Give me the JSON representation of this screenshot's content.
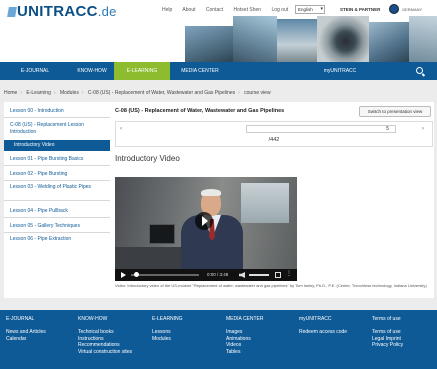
{
  "header": {
    "logo_text": "UNITRACC",
    "logo_domain": ".de",
    "top_links": [
      "Help",
      "About",
      "Contact",
      "Hotset Shen",
      "Log out"
    ],
    "language": "English",
    "partner": "STEIN & PARTNER",
    "partner_country": "GERMANY"
  },
  "nav": {
    "items": [
      "E-JOURNAL",
      "KNOW-HOW",
      "E-LEARNING",
      "MEDIA CENTER",
      "myUNITRACC"
    ],
    "active_index": 2
  },
  "breadcrumb": [
    "Home",
    "E-Learning",
    "Modules",
    "C-08 (US) - Replacement of Water, Wastewater and Gas Pipelines",
    "course view"
  ],
  "sidebar": {
    "items": [
      "Lesson 00 - Introduction",
      "C-08 (US) - Replacement Lesson Introduction",
      "Introductory Video",
      "Lesson 01 - Pipe Bursting Basics",
      "Lesson 02 - Pipe Bursting",
      "Lesson 03 - Welding of Plastic Pipes",
      "Lesson 04 - Pipe Pullback",
      "Lesson 05 - Gallery Techniques",
      "Lesson 06 - Pipe Extraction"
    ],
    "active_index": 2
  },
  "main": {
    "lesson_title": "C-08 (US) - Replacement of Water, Wastewater and Gas Pipelines",
    "switch_button": "Switch to presentation view",
    "page_current": "5",
    "page_total": "/442",
    "section_title": "Introductory Video",
    "video_time": "0:00 / 3:48",
    "caption": "Video: Introductory video of the US-module \"Replacement of water, wastewater and gas pipelines\" by Tom Iseley, Ph.D., P.E. (Center, Trenchless technology, Indiana University)"
  },
  "footer": {
    "columns": [
      {
        "heading": "E-JOURNAL",
        "links": [
          "News and Articles",
          "Calendar"
        ]
      },
      {
        "heading": "KNOW-HOW",
        "links": [
          "Technical books",
          "Instructions",
          "Recommendations",
          "Virtual construction sites"
        ]
      },
      {
        "heading": "E-LEARNING",
        "links": [
          "Lessons",
          "Modules"
        ]
      },
      {
        "heading": "MEDIA CENTER",
        "links": [
          "Images",
          "Animations",
          "Videos",
          "Tables"
        ]
      },
      {
        "heading": "myUNITRACC",
        "links": [
          "Redeem access code"
        ]
      },
      {
        "heading": "Terms of use",
        "links": [
          "Terms of use",
          "Legal Imprint",
          "Privacy Policy"
        ]
      }
    ]
  },
  "colors": {
    "primary": "#0e5a97",
    "accent": "#8dbd2f",
    "background": "#ececec"
  }
}
